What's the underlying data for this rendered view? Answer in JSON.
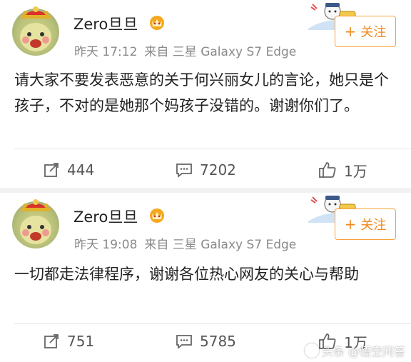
{
  "posts": [
    {
      "username": "Zero旦旦",
      "time": "昨天 17:12",
      "source": "来自 三星 Galaxy S7 Edge",
      "follow_label": "关注",
      "content": "请大家不要发表恶意的关于何兴丽女儿的言论，她只是个孩子，不对的是她那个妈孩子没错的。谢谢你们了。",
      "reposts": "444",
      "comments": "7202",
      "likes": "1万"
    },
    {
      "username": "Zero旦旦",
      "time": "昨天 19:08",
      "source": "来自 三星 Galaxy S7 Edge",
      "follow_label": "关注",
      "content": "一切都走法律程序，谢谢各位热心网友的关心与帮助",
      "reposts": "751",
      "comments": "5785",
      "likes": "1万"
    }
  ],
  "watermark": "头条 @悟空问答",
  "icons": {
    "avatar": "avatar-icon",
    "crown": "crown-icon",
    "mascot": "mascot-icon",
    "follow": "plus-icon",
    "repost": "repost-icon",
    "comment": "comment-icon",
    "like": "thumbs-up-icon"
  },
  "colors": {
    "follow_accent": "#f08a1e",
    "meta_text": "#8a8a8a",
    "background": "#f2f2f2"
  }
}
